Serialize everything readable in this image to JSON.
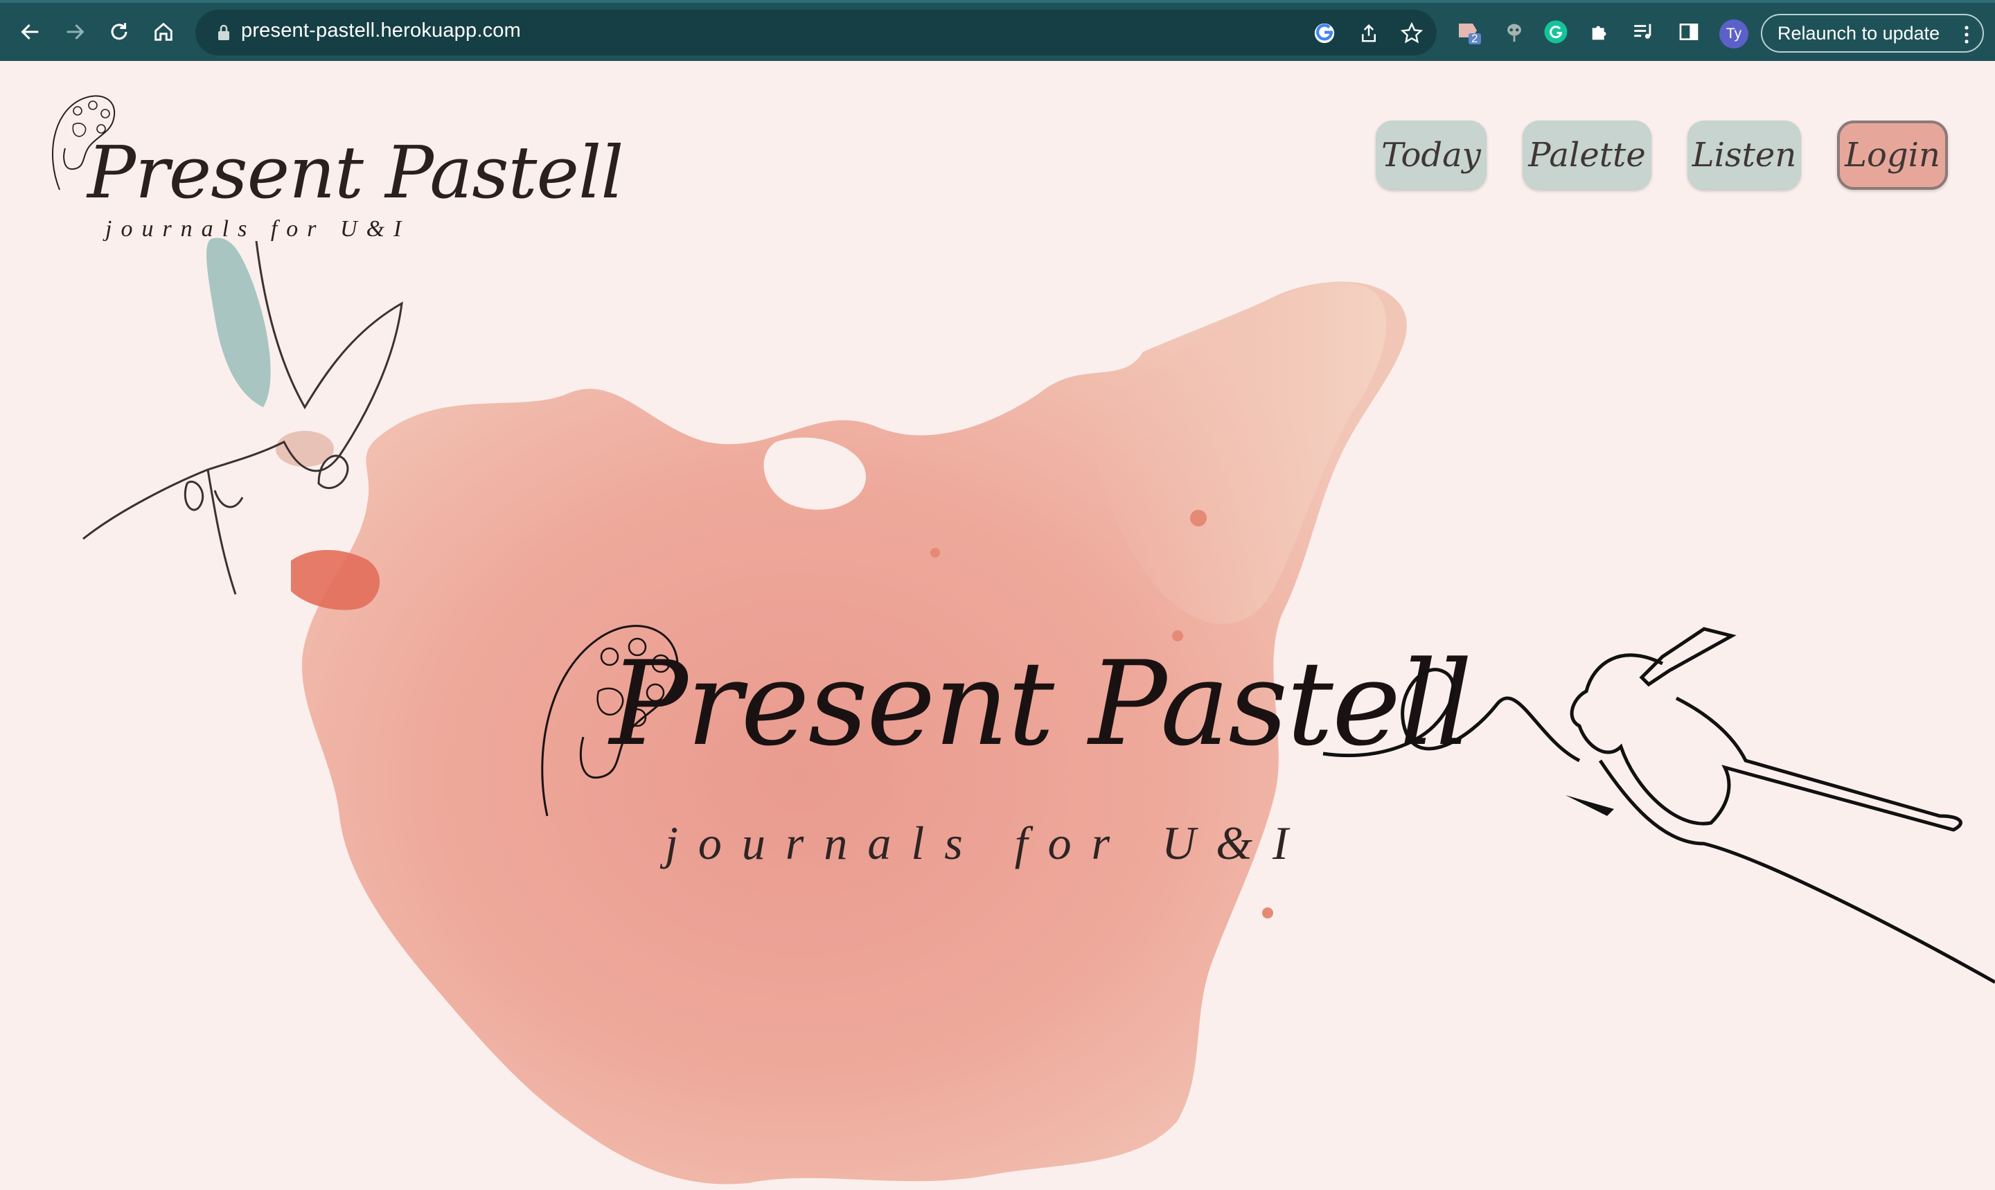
{
  "browser": {
    "url": "present-pastell.herokuapp.com",
    "relaunch_label": "Relaunch to update",
    "profile_initials": "Ty",
    "extension_badge": "2"
  },
  "brand": {
    "title": "Present Pastell",
    "tagline": "journals for U&I"
  },
  "nav": {
    "items": [
      {
        "label": "Today"
      },
      {
        "label": "Palette"
      },
      {
        "label": "Listen"
      }
    ],
    "login_label": "Login"
  },
  "hero": {
    "title": "Present Pastell",
    "tagline": "journals for U&I"
  },
  "colors": {
    "chrome": "#1f5158",
    "page_background": "#faefec",
    "nav_pill": "#c7d4cf",
    "login_pill": "#e6a79a",
    "splash": "#e9a196"
  }
}
